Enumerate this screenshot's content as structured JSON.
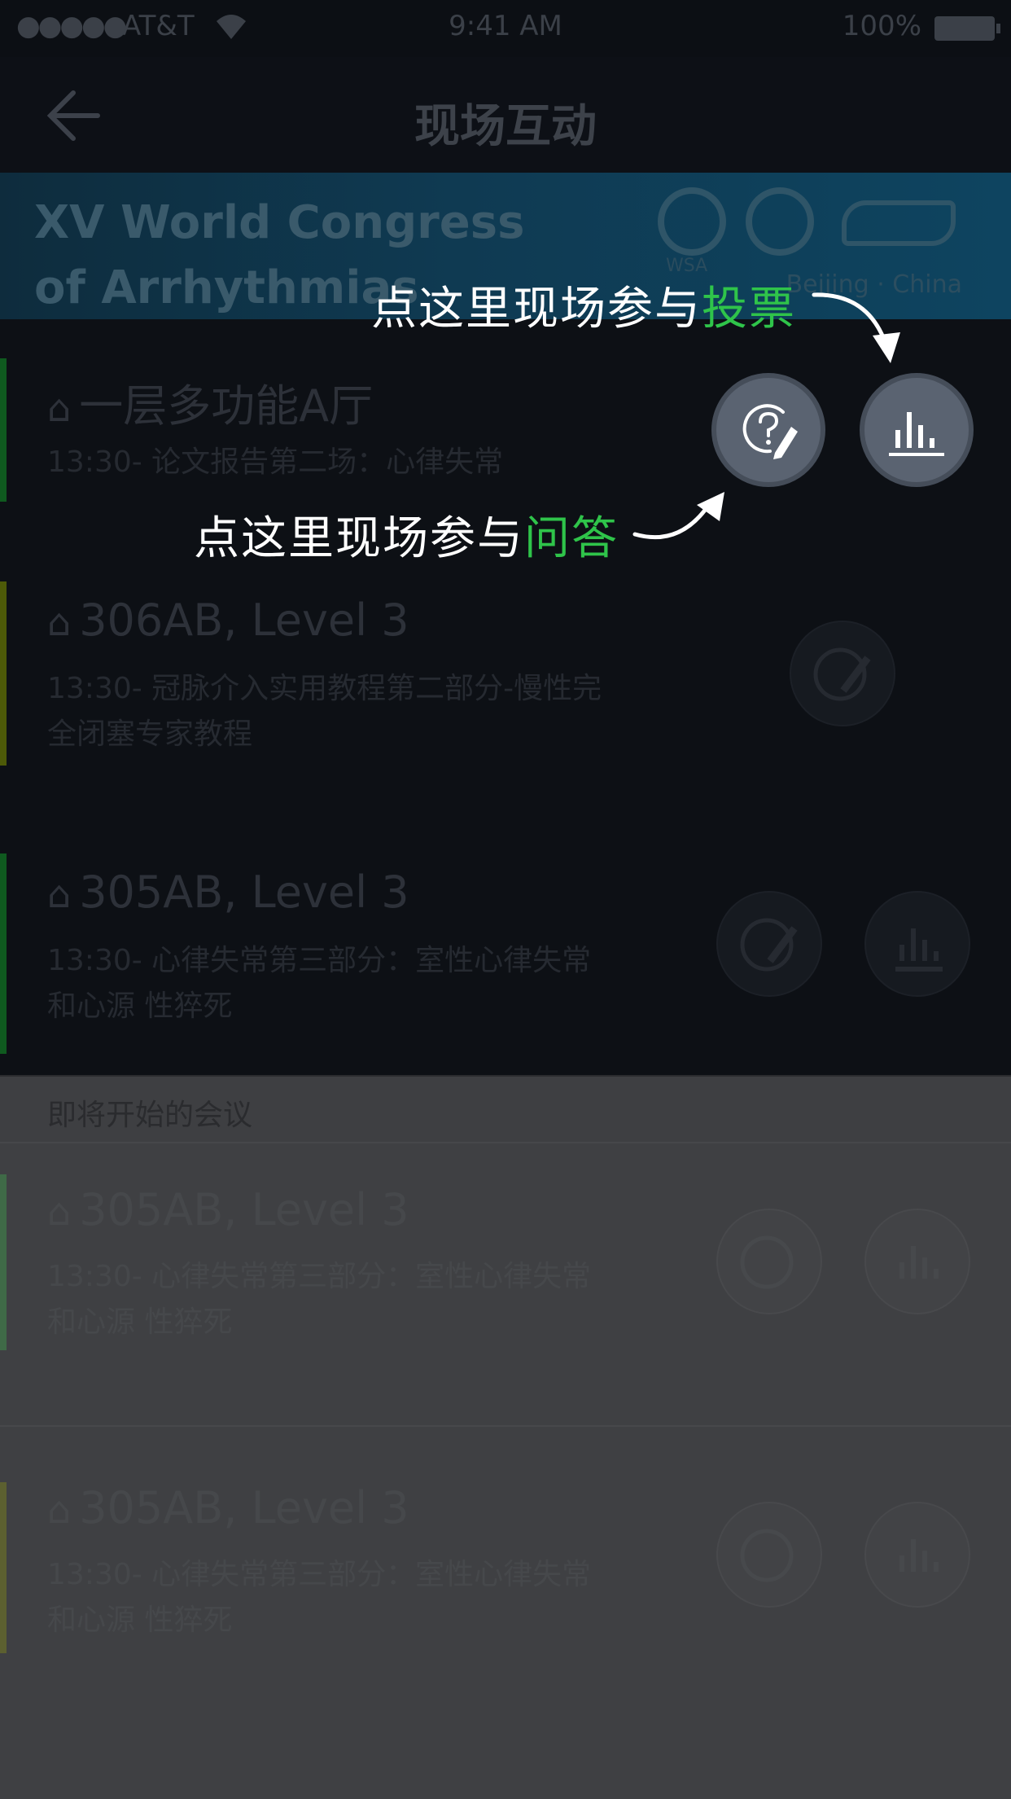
{
  "status_bar": {
    "signal": "●●●●●",
    "carrier": "AT&T",
    "wifi_icon": "wifi-icon",
    "time": "9:41 AM",
    "battery": "100%"
  },
  "nav": {
    "title": "现场互动",
    "back_icon": "back-arrow-icon"
  },
  "banner": {
    "title": "XV World Congress\nof Arrhythmias",
    "logo_label": "WSA",
    "location": "Beijing · China"
  },
  "sessions": [
    {
      "room": "一层多功能A厅",
      "desc": "13:30- 论文报告第二场：心律失常",
      "bar_color": "#0f5a1f"
    },
    {
      "room": "306AB, Level 3",
      "desc": "13:30- 冠脉介入实用教程第二部分-慢性完全闭塞专家教程",
      "bar_color": "#4d5a08"
    },
    {
      "room": "305AB, Level 3",
      "desc": "13:30- 心律失常第三部分：室性心律失常和心源 性猝死",
      "bar_color": "#0f5a1f"
    }
  ],
  "upcoming": {
    "header": "即将开始的会议",
    "sessions": [
      {
        "room": "305AB, Level 3",
        "desc": "13:30- 心律失常第三部分：室性心律失常和心源 性猝死",
        "bar_color": "#3f6a47"
      },
      {
        "room": "305AB, Level 3",
        "desc": "13:30- 心律失常第三部分：室性心律失常和心源 性猝死",
        "bar_color": "#5c6030"
      }
    ]
  },
  "overlay": {
    "vote_hint_prefix": "点这里现场参与",
    "vote_hint_highlight": "投票",
    "qa_hint_prefix": "点这里现场参与",
    "qa_hint_highlight": "问答",
    "qa_icon": "question-pencil-icon",
    "vote_icon": "bar-chart-icon",
    "highlight_color": "#2fc44a"
  }
}
